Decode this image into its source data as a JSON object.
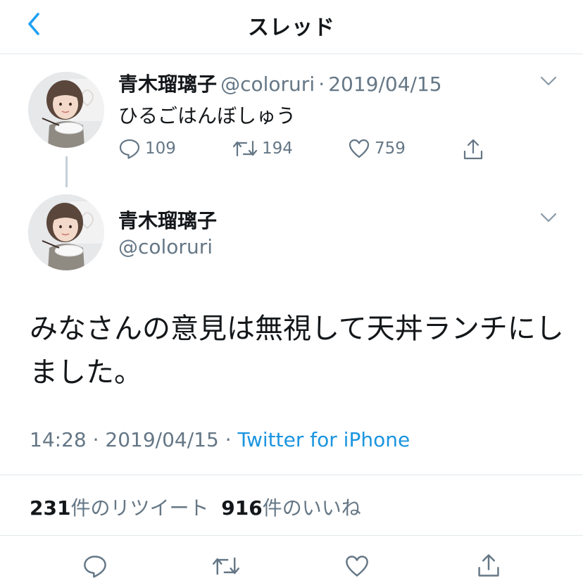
{
  "header": {
    "title": "スレッド"
  },
  "thread_tweet": {
    "display_name": "青木瑠璃子",
    "handle": "@coloruri",
    "separator": "·",
    "date": "2019/04/15",
    "text": "ひるごはんぼしゅう",
    "replies": "109",
    "retweets": "194",
    "likes": "759"
  },
  "main_tweet": {
    "display_name": "青木瑠璃子",
    "handle": "@coloruri",
    "text": "みなさんの意見は無視して天丼ランチにしました。",
    "time": "14:28",
    "separator1": "·",
    "date": "2019/04/15",
    "separator2": "·",
    "source": "Twitter for iPhone",
    "retweet_count": "231",
    "retweet_label": "件のリツイート",
    "like_count": "916",
    "like_label": "件のいいね"
  },
  "icons": {
    "back": "chevron-left-icon",
    "menu": "chevron-down-icon",
    "reply": "reply-icon",
    "retweet": "retweet-icon",
    "like": "heart-icon",
    "share": "share-icon"
  },
  "colors": {
    "accent": "#1da1f2",
    "link": "#1b95e0",
    "secondary_text": "#657786",
    "border": "#e1e8ed"
  }
}
